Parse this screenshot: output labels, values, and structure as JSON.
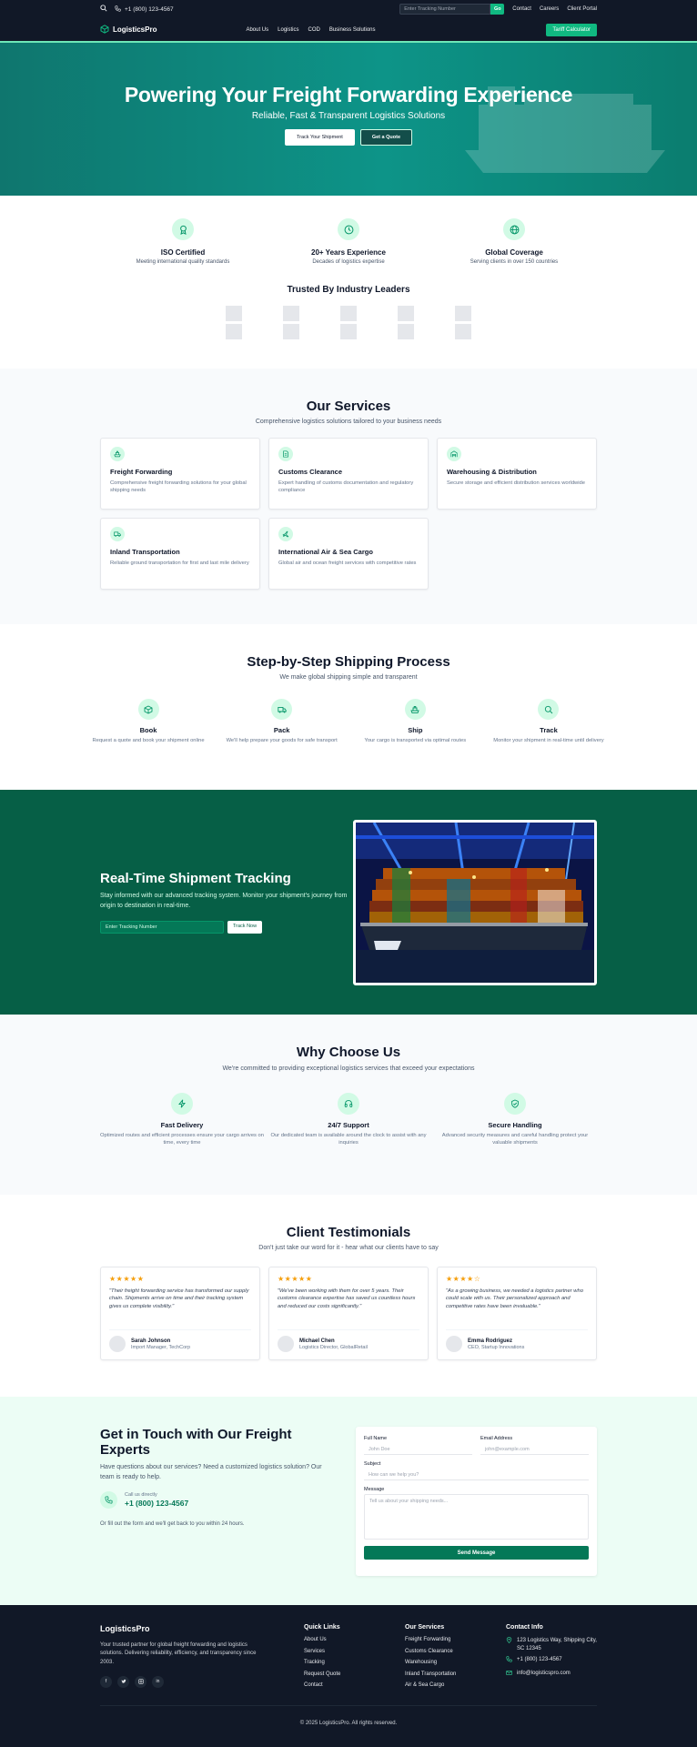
{
  "topbar": {
    "phone": "+1 (800) 123-4567",
    "tracking_placeholder": "Enter Tracking Number",
    "tracking_button": "Go",
    "links": [
      "Contact",
      "Careers",
      "Client Portal"
    ]
  },
  "nav": {
    "brand": "LogisticsPro",
    "links": [
      "About Us",
      "Logistics",
      "COD",
      "Business Solutions"
    ],
    "cta": "Tariff Calculator"
  },
  "hero": {
    "title": "Powering Your Freight Forwarding Experience",
    "subtitle": "Reliable, Fast & Transparent Logistics Solutions",
    "btn_track": "Track Your Shipment",
    "btn_quote": "Get a Quote"
  },
  "badges": [
    {
      "icon": "award-icon",
      "title": "ISO Certified",
      "desc": "Meeting international quality standards"
    },
    {
      "icon": "clock-icon",
      "title": "20+ Years Experience",
      "desc": "Decades of logistics expertise"
    },
    {
      "icon": "globe-icon",
      "title": "Global Coverage",
      "desc": "Serving clients in over 150 countries"
    }
  ],
  "trusted_title": "Trusted By Industry Leaders",
  "services": {
    "title": "Our Services",
    "subtitle": "Comprehensive logistics solutions tailored to your business needs",
    "items": [
      {
        "icon": "ship-icon",
        "title": "Freight Forwarding",
        "desc": "Comprehensive freight forwarding solutions for your global shipping needs"
      },
      {
        "icon": "document-icon",
        "title": "Customs Clearance",
        "desc": "Expert handling of customs documentation and regulatory compliance"
      },
      {
        "icon": "warehouse-icon",
        "title": "Warehousing & Distribution",
        "desc": "Secure storage and efficient distribution services worldwide"
      },
      {
        "icon": "truck-icon",
        "title": "Inland Transportation",
        "desc": "Reliable ground transportation for first and last mile delivery"
      },
      {
        "icon": "plane-icon",
        "title": "International Air & Sea Cargo",
        "desc": "Global air and ocean freight services with competitive rates"
      }
    ]
  },
  "process": {
    "title": "Step-by-Step Shipping Process",
    "subtitle": "We make global shipping simple and transparent",
    "steps": [
      {
        "icon": "box-icon",
        "title": "Book",
        "desc": "Request a quote and book your shipment online"
      },
      {
        "icon": "truck-icon",
        "title": "Pack",
        "desc": "We'll help prepare your goods for safe transport"
      },
      {
        "icon": "ship-icon",
        "title": "Ship",
        "desc": "Your cargo is transported via optimal routes"
      },
      {
        "icon": "search-icon",
        "title": "Track",
        "desc": "Monitor your shipment in real-time until delivery"
      }
    ]
  },
  "tracking": {
    "title": "Real-Time Shipment Tracking",
    "desc": "Stay informed with our advanced tracking system. Monitor your shipment's journey from origin to destination in real-time.",
    "placeholder": "Enter Tracking Number",
    "button": "Track Now"
  },
  "why": {
    "title": "Why Choose Us",
    "subtitle": "We're committed to providing exceptional logistics services that exceed your expectations",
    "items": [
      {
        "icon": "lightning-icon",
        "title": "Fast Delivery",
        "desc": "Optimized routes and efficient processes ensure your cargo arrives on time, every time"
      },
      {
        "icon": "headset-icon",
        "title": "24/7 Support",
        "desc": "Our dedicated team is available around the clock to assist with any inquiries"
      },
      {
        "icon": "shield-check-icon",
        "title": "Secure Handling",
        "desc": "Advanced security measures and careful handling protect your valuable shipments"
      }
    ]
  },
  "testimonials": {
    "title": "Client Testimonials",
    "subtitle": "Don't just take our word for it - hear what our clients have to say",
    "items": [
      {
        "stars": "★★★★★",
        "quote": "\"Their freight forwarding service has transformed our supply chain. Shipments arrive on time and their tracking system gives us complete visibility.\"",
        "name": "Sarah Johnson",
        "role": "Import Manager, TechCorp"
      },
      {
        "stars": "★★★★★",
        "quote": "\"We've been working with them for over 5 years. Their customs clearance expertise has saved us countless hours and reduced our costs significantly.\"",
        "name": "Michael Chen",
        "role": "Logistics Director, GlobalRetail"
      },
      {
        "stars": "★★★★☆",
        "quote": "\"As a growing business, we needed a logistics partner who could scale with us. Their personalized approach and competitive rates have been invaluable.\"",
        "name": "Emma Rodriguez",
        "role": "CEO, Startup Innovations"
      }
    ]
  },
  "contact": {
    "title": "Get in Touch with Our Freight Experts",
    "desc": "Have questions about our services? Need a customized logistics solution? Our team is ready to help.",
    "call_label": "Call us directly",
    "call_number": "+1 (800) 123-4567",
    "note": "Or fill out the form and we'll get back to you within 24 hours.",
    "form": {
      "name_label": "Full Name",
      "name_placeholder": "John Doe",
      "email_label": "Email Address",
      "email_placeholder": "john@example.com",
      "subject_label": "Subject",
      "subject_placeholder": "How can we help you?",
      "message_label": "Message",
      "message_placeholder": "Tell us about your shipping needs...",
      "submit": "Send Message"
    }
  },
  "footer": {
    "brand": "LogisticsPro",
    "desc": "Your trusted partner for global freight forwarding and logistics solutions. Delivering reliability, efficiency, and transparency since 2003.",
    "socials": [
      "facebook-icon",
      "twitter-icon",
      "instagram-icon",
      "linkedin-icon"
    ],
    "quick_title": "Quick Links",
    "quick_links": [
      "About Us",
      "Services",
      "Tracking",
      "Request Quote",
      "Contact"
    ],
    "services_title": "Our Services",
    "services_links": [
      "Freight Forwarding",
      "Customs Clearance",
      "Warehousing",
      "Inland Transportation",
      "Air & Sea Cargo"
    ],
    "info_title": "Contact Info",
    "address": "123 Logistics Way, Shipping City, SC 12345",
    "phone": "+1 (800) 123-4567",
    "email": "info@logisticspro.com",
    "copyright": "© 2025 LogisticsPro. All rights reserved."
  },
  "colors": {
    "accent": "#10b981",
    "dark": "#111827",
    "brand_green": "#065f46"
  }
}
